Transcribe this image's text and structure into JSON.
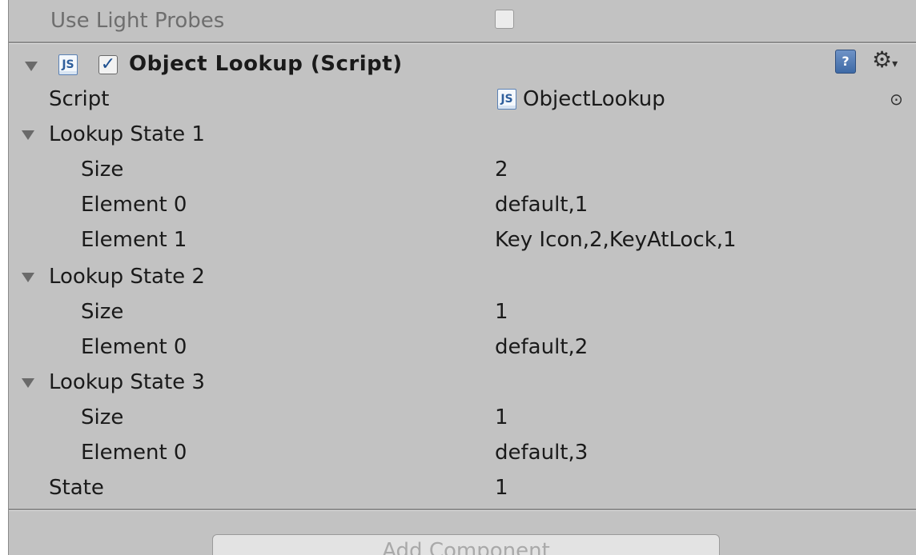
{
  "inspector": {
    "prev_component": {
      "use_light_probes_label": "Use Light Probes",
      "use_light_probes_checked": false
    },
    "component": {
      "js_icon_text": "JS",
      "enabled": true,
      "title": "Object Lookup (Script)",
      "help_icon_text": "?",
      "settings_icon_glyph": "⚙",
      "script": {
        "label": "Script",
        "value": "ObjectLookup",
        "picker_icon_glyph": "⊙"
      },
      "lookup_states": [
        {
          "label": "Lookup State 1",
          "size_label": "Size",
          "size_value": "2",
          "elements": [
            {
              "label": "Element 0",
              "value": "default,1"
            },
            {
              "label": "Element 1",
              "value": "Key Icon,2,KeyAtLock,1"
            }
          ]
        },
        {
          "label": "Lookup State 2",
          "size_label": "Size",
          "size_value": "1",
          "elements": [
            {
              "label": "Element 0",
              "value": "default,2"
            }
          ]
        },
        {
          "label": "Lookup State 3",
          "size_label": "Size",
          "size_value": "1",
          "elements": [
            {
              "label": "Element 0",
              "value": "default,3"
            }
          ]
        }
      ],
      "state": {
        "label": "State",
        "value": "1"
      }
    },
    "add_component_label": "Add Component"
  },
  "icons": {
    "foldout": "triangle-down-icon",
    "script": "js-script-icon",
    "help": "help-book-icon",
    "settings": "gear-icon",
    "picker": "object-picker-icon"
  },
  "colors": {
    "panel_bg": "#c2c2c2",
    "text": "#1a1a1a",
    "js_blue": "#2f5f9c",
    "checkbox_check": "#1d4f8f"
  }
}
